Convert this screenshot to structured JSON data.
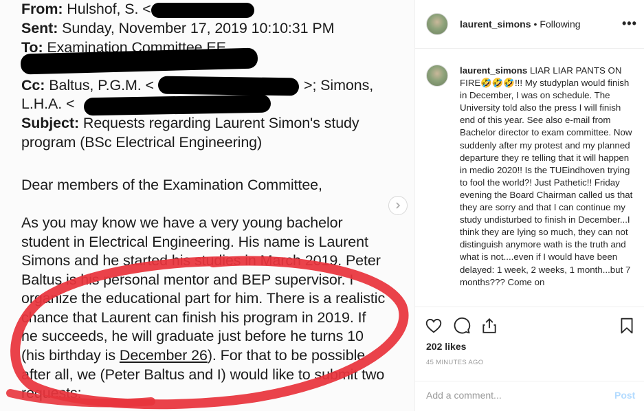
{
  "letter": {
    "from_label": "From:",
    "from_value": "Hulshof, S. <",
    "sent_label": "Sent:",
    "sent_value": "Sunday, November 17, 2019 10:10:31 PM",
    "to_label": "To:",
    "to_value": "Examination Committee EE",
    "cc_label": "Cc:",
    "cc_value_1": "Baltus, P.G.M. <",
    "cc_value_1b": ">; Simons,",
    "cc_value_2": "L.H.A. <",
    "subject_label": "Subject:",
    "subject_value_1": "Requests regarding Laurent Simon's study",
    "subject_value_2": "program (BSc Electrical Engineering)",
    "greeting": "Dear members of the Examination Committee,",
    "body_lines": [
      "As you may know we have a very young bachelor",
      "student in Electrical Engineering. His name is Laurent",
      "Simons and he started his studies in March 2019. Peter",
      "Baltus is his personal mentor and BEP supervisor. I",
      "organize the educational part for him. There is a realistic",
      "chance that Laurent can finish his program in 2019. If",
      "he succeeds, he will graduate just before he turns 10"
    ],
    "line_birthday_pre": "(his birthday is ",
    "line_birthday_date": "December 26",
    "line_birthday_post": "). For that to be possible",
    "line_after": "after all, we (Peter Baltus and I) would like to submit two",
    "line_requests": "requests:"
  },
  "post": {
    "username": "laurent_simons",
    "separator": "•",
    "follow_status": "Following",
    "more_glyph": "•••",
    "caption_username": "laurent_simons",
    "caption_text": "LIAR LIAR PANTS ON FIRE🤣🤣🤣!!! My studyplan would finish in December, I was on schedule. The University told also the press I will finish end of this year. See also e-mail from Bachelor director to exam committee. Now suddenly after my protest and my planned departure they re telling that it will happen in medio 2020!! Is the TUEindhoven trying to fool the world?! Just Pathetic!! Friday evening the Board Chairman called us that they are sorry and that I can continue my study undisturbed to finish in December...I think they are lying so much, they can not distinguish anymore wath is the truth and what is not....even if I would have been delayed: 1 week, 2 weeks, 1 month...but 7 months??? Come on",
    "likes": "202 likes",
    "time_ago": "45 MINUTES AGO",
    "comment_placeholder": "Add a comment...",
    "post_label": "Post"
  },
  "colors": {
    "red_circle": "#e8343c",
    "post_button": "#b3dbff",
    "muted": "#999999",
    "text": "#262626"
  },
  "icons": [
    "heart-icon",
    "comment-icon",
    "share-icon",
    "bookmark-icon",
    "chevron-right-icon",
    "more-options-icon"
  ]
}
